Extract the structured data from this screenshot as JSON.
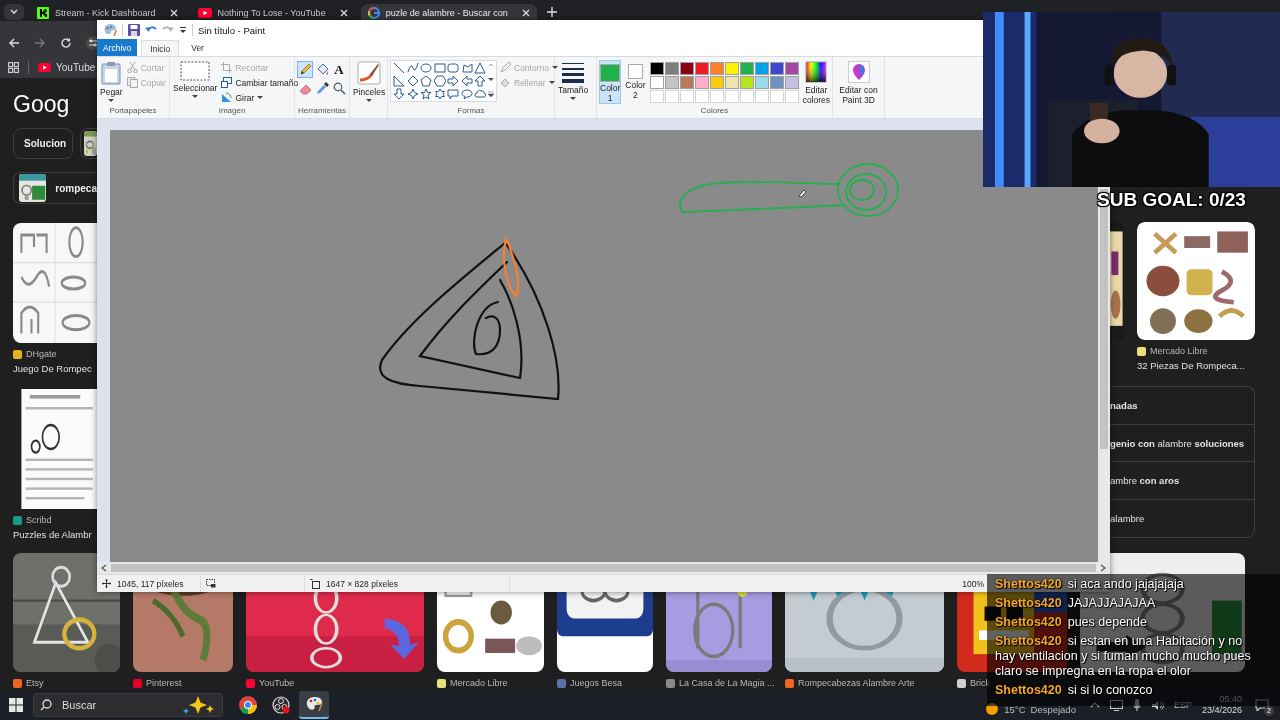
{
  "browser": {
    "tabs": [
      {
        "title": "Stream - Kick Dashboard",
        "selected": false
      },
      {
        "title": "Nothing To Lose - YouTube",
        "selected": false
      },
      {
        "title": "puzle de alambre - Buscar con",
        "selected": true
      }
    ],
    "bookmarks": [
      {
        "label": "YouTube"
      }
    ],
    "page": {
      "logo": "Goog",
      "chips": [
        {
          "label": "Solucion"
        },
        {
          "label": "rompeca"
        }
      ],
      "left_results": [
        {
          "source": "DHgate",
          "color": "#e8b21c",
          "title": "Juego De Rompec"
        },
        {
          "source": "Scribd",
          "color": "#1b9a8a",
          "title": "Puzzles de Alambr"
        }
      ],
      "right_results": [
        {
          "source": "Mercado Libre",
          "color": "#e9e27a",
          "title": "32 Piezas De Rompeca..."
        }
      ],
      "related_searches": [
        {
          "text": "nadas",
          "bold": true
        },
        {
          "text": "**genio con** alambre **soluciones**",
          "bold": false
        },
        {
          "text": "ambre **con aros**",
          "bold": false
        },
        {
          "text": "alambre",
          "bold": false
        }
      ],
      "thumbnails": [
        {
          "source": "Etsy",
          "color": "#f1641e"
        },
        {
          "source": "Pinterest",
          "color": "#e60023"
        },
        {
          "source": "YouTube",
          "color": "#ff0033"
        },
        {
          "source": "Mercado Libre",
          "color": "#e9e27a"
        },
        {
          "source": "Juegos Besa",
          "color": "#5b6fa8"
        },
        {
          "source": "La Casa de La Magia ...",
          "color": "#8a8a8a"
        },
        {
          "source": "Rompecabezas Alambre Arte",
          "color": "#f26522"
        },
        {
          "source": "Brick",
          "color": "#cfcfcf"
        },
        {
          "kind": "picture"
        }
      ]
    }
  },
  "paint": {
    "title": "Sin título - Paint",
    "tabs": [
      {
        "label": "Archivo",
        "kind": "file",
        "selected": false
      },
      {
        "label": "Inicio",
        "kind": "tab",
        "selected": true
      },
      {
        "label": "Ver",
        "kind": "tab",
        "selected": false
      }
    ],
    "clipboard": {
      "label": "Portapapeles",
      "paste": "Pegar",
      "cut": {
        "label": "Cortar",
        "disabled": true
      },
      "copy": {
        "label": "Copiar",
        "disabled": true
      }
    },
    "image": {
      "label": "Imagen",
      "select": "Seleccionar",
      "crop": {
        "label": "Recortar",
        "disabled": true
      },
      "resize": {
        "label": "Cambiar tamaño",
        "disabled": false
      },
      "rotate": {
        "label": "Girar",
        "disabled": false
      }
    },
    "tools": {
      "label": "Herramientas",
      "items": [
        {
          "kind": "pencil",
          "selected": true
        },
        {
          "kind": "fill",
          "selected": false
        },
        {
          "kind": "text",
          "glyph": "A",
          "selected": false
        },
        {
          "kind": "eraser",
          "selected": false
        },
        {
          "kind": "picker",
          "selected": false
        },
        {
          "kind": "magnifier",
          "selected": false
        }
      ]
    },
    "brushes": "Pinceles",
    "shapes": {
      "label": "Formas",
      "outline": {
        "label": "Contorno",
        "disabled": true
      },
      "fill": {
        "label": "Rellenar",
        "disabled": true
      }
    },
    "size": "Tamaño",
    "colors": {
      "label": "Colores",
      "slots": [
        {
          "label": "Color",
          "number": "1",
          "color": "#22b14c",
          "selected": true
        },
        {
          "label": "Color",
          "number": "2",
          "color": "#ffffff",
          "selected": false
        }
      ],
      "palette": [
        {
          "kind": "swatch",
          "color": "#000000"
        },
        {
          "kind": "swatch",
          "color": "#7f7f7f"
        },
        {
          "kind": "swatch",
          "color": "#880015"
        },
        {
          "kind": "swatch",
          "color": "#ed1c24"
        },
        {
          "kind": "swatch",
          "color": "#ff7f27"
        },
        {
          "kind": "swatch",
          "color": "#fff200"
        },
        {
          "kind": "swatch",
          "color": "#22b14c"
        },
        {
          "kind": "swatch",
          "color": "#00a2e8"
        },
        {
          "kind": "swatch",
          "color": "#3f48cc"
        },
        {
          "kind": "swatch",
          "color": "#a349a4"
        },
        {
          "kind": "swatch",
          "color": "#ffffff"
        },
        {
          "kind": "swatch",
          "color": "#c3c3c3"
        },
        {
          "kind": "swatch",
          "color": "#b97a57"
        },
        {
          "kind": "swatch",
          "color": "#ffaec9"
        },
        {
          "kind": "swatch",
          "color": "#ffc90e"
        },
        {
          "kind": "swatch",
          "color": "#efe4b0"
        },
        {
          "kind": "swatch",
          "color": "#b5e61d"
        },
        {
          "kind": "swatch",
          "color": "#99d9ea"
        },
        {
          "kind": "swatch",
          "color": "#7092be"
        },
        {
          "kind": "swatch",
          "color": "#c8bfe7"
        },
        {
          "kind": "empty"
        },
        {
          "kind": "empty"
        },
        {
          "kind": "empty"
        },
        {
          "kind": "empty"
        },
        {
          "kind": "empty"
        },
        {
          "kind": "empty"
        },
        {
          "kind": "empty"
        },
        {
          "kind": "empty"
        },
        {
          "kind": "empty"
        },
        {
          "kind": "empty"
        }
      ],
      "edit": "Editar colores"
    },
    "paint3d": "Editar con Paint 3D",
    "status": {
      "position": "1045, 117 píxeles",
      "size": "1647 × 828 píxeles",
      "zoom": "100%"
    }
  },
  "stream": {
    "webcam": {
      "kind": "picture"
    },
    "sub_goal": "SUB GOAL: 0/23",
    "chat": [
      {
        "user": "Shettos420",
        "text": "si aca ando jajajajaja"
      },
      {
        "user": "Shettos420",
        "text": "JAJAJJAJAJAA"
      },
      {
        "user": "Shettos420",
        "text": "pues depende"
      },
      {
        "user": "Shettos420",
        "text": "si estan en una Habitación y no hay ventilacion y si fuman mucho mucho pues claro se impregna en la ropa el olor"
      },
      {
        "user": "Shettos420",
        "text": "si si lo conozco"
      }
    ]
  },
  "taskbar": {
    "search": {
      "placeholder": "Buscar"
    },
    "apps": [
      {
        "selected": false
      },
      {
        "selected": false
      },
      {
        "selected": true
      }
    ],
    "weather": {
      "temperature": "15°C",
      "condition": "Despejado"
    },
    "language": "ESP",
    "time": "05:40",
    "date": "23/4/2026",
    "notifications": "2"
  }
}
